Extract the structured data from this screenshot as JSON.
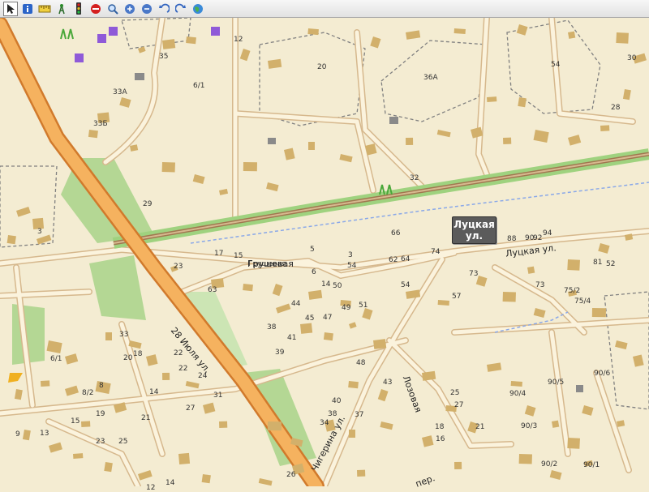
{
  "toolbar": {
    "buttons": [
      {
        "name": "arrow-select-tool",
        "icon": "cursor-arrow-icon"
      },
      {
        "name": "info-tool",
        "icon": "info-icon"
      },
      {
        "name": "measure-tool",
        "icon": "ruler-icon"
      },
      {
        "name": "poi-tool",
        "icon": "antenna-icon"
      },
      {
        "name": "traffic-tool",
        "icon": "traffic-light-icon"
      },
      {
        "name": "stop-tool",
        "icon": "no-entry-icon"
      },
      {
        "name": "search-tool",
        "icon": "magnifier-icon"
      },
      {
        "name": "zoom-in-tool",
        "icon": "zoom-in-icon"
      },
      {
        "name": "zoom-out-tool",
        "icon": "zoom-out-icon"
      },
      {
        "name": "undo-tool",
        "icon": "undo-icon"
      },
      {
        "name": "redo-tool",
        "icon": "redo-icon"
      },
      {
        "name": "globe-tool",
        "icon": "globe-icon"
      }
    ]
  },
  "map": {
    "colors": {
      "background": "#f4ecd2",
      "road_casing": "#d6b88d",
      "road_fill": "#fbf3dd",
      "trunk_casing": "#d17a2c",
      "trunk_fill": "#f5b25f",
      "railway": "#a07850",
      "building": "#d2b06b",
      "park": "#a8d48a",
      "boundary": "#808080",
      "water": "#8aa8e8"
    },
    "callout": {
      "line1": "Луцкая",
      "line2": "ул."
    },
    "streets": [
      {
        "id": "luckaya",
        "text": "Луцкая ул."
      },
      {
        "id": "grushevaya",
        "text": "Грушевая"
      },
      {
        "id": "iyulya",
        "text": "28 Июля ул."
      },
      {
        "id": "lozovaya",
        "text": "Лозовая"
      },
      {
        "id": "chigerina",
        "text": "Чигерина ул."
      },
      {
        "id": "bottom-partial",
        "text": "пер."
      }
    ],
    "house_numbers": [
      "12",
      "35",
      "20",
      "36А",
      "54",
      "30",
      "6/1",
      "33А",
      "33Б",
      "28",
      "32",
      "29",
      "3",
      "66",
      "88",
      "90",
      "92",
      "94",
      "74",
      "17",
      "15",
      "5",
      "3",
      "64",
      "62",
      "23",
      "Грушевая",
      "6",
      "54",
      "73",
      "81",
      "52",
      "50",
      "14",
      "63",
      "73",
      "75/2",
      "44",
      "49",
      "51",
      "54",
      "75/4",
      "57",
      "33",
      "38",
      "45",
      "47",
      "41",
      "20",
      "18",
      "22",
      "39",
      "6/1",
      "48",
      "90/6",
      "8",
      "22",
      "24",
      "43",
      "90/5",
      "14",
      "27",
      "90/4",
      "8/2",
      "31",
      "40",
      "25",
      "27",
      "38",
      "19",
      "15",
      "21",
      "37",
      "90/3",
      "34",
      "18",
      "16",
      "21",
      "9",
      "13",
      "23",
      "25",
      "26",
      "90/2",
      "90/1",
      "14",
      "12"
    ]
  }
}
